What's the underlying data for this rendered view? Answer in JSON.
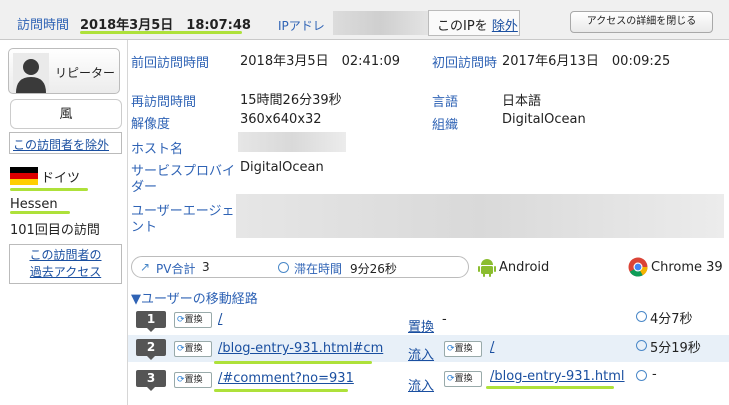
{
  "header": {
    "visit_time_label": "訪問時間",
    "visit_time_value": "2018年3月5日　18:07:48",
    "ip_label": "IPアドレ",
    "exclude_ip_prefix": "このIPを",
    "exclude_ip_link": "除外",
    "close_details_button": "アクセスの詳細を閉じる"
  },
  "sidebar": {
    "visitor_type": "リピーター",
    "personality": "風",
    "exclude_visitor": "この訪問者を除外",
    "country": "ドイツ",
    "region": "Hessen",
    "visit_count": "101回目の訪問",
    "past_access_line1": "この訪問者の",
    "past_access_line2": "過去アクセス"
  },
  "info": {
    "prev_visit_label": "前回訪問時間",
    "prev_visit_value": "2018年3月5日　02:41:09",
    "first_visit_label": "初回訪問時",
    "first_visit_value": "2017年6月13日　00:09:25",
    "revisit_label": "再訪問時間",
    "revisit_value": "15時間26分39秒",
    "language_label": "言語",
    "language_value": "日本語",
    "resolution_label": "解像度",
    "resolution_value": "360x640x32",
    "org_label": "組織",
    "org_value": "DigitalOcean",
    "host_label": "ホスト名",
    "provider_label_1": "サービスプロバイ",
    "provider_label_2": "ダー",
    "provider_value": "DigitalOcean",
    "ua_label_1": "ユーザーエージェ",
    "ua_label_2": "ント"
  },
  "stats": {
    "pv_label": "PV合計",
    "pv_value": "3",
    "stay_label": "滞在時間",
    "stay_value": "9分26秒",
    "os": "Android",
    "browser": "Chrome 39"
  },
  "path": {
    "title": "▼ユーザーの移動経路",
    "swap_label": "置換",
    "inflow_label": "流入",
    "rows": [
      {
        "num": "1",
        "page": "/",
        "referrer": "-",
        "time": "4分7秒"
      },
      {
        "num": "2",
        "page": "/blog-entry-931.html#cm",
        "referrer": "/",
        "time": "5分19秒"
      },
      {
        "num": "3",
        "page": "/#comment?no=931",
        "referrer": "/blog-entry-931.html",
        "time": "-"
      }
    ]
  },
  "colors": {
    "highlight": "#aee13a",
    "label_blue": "#2f63b5",
    "link_blue": "#1a4fa0",
    "flag_black": "#000000",
    "flag_red": "#dd0000",
    "flag_gold": "#ffce00"
  }
}
